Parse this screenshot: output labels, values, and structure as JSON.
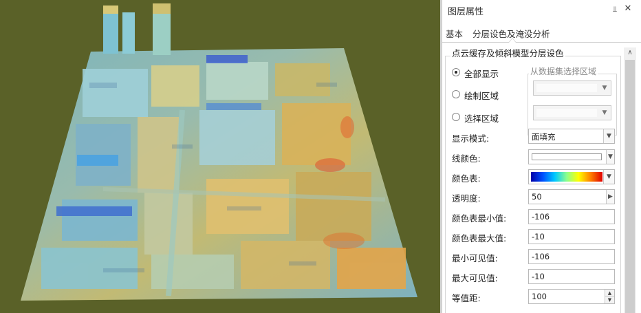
{
  "panel": {
    "title": "图层属性",
    "pin_icon": "pin-icon",
    "close_icon": "close-icon",
    "tabs": [
      {
        "label": "基本"
      },
      {
        "label": "分层设色及淹没分析"
      }
    ]
  },
  "group": {
    "title": "点云缓存及倾斜模型分层设色",
    "radios": [
      {
        "label": "全部显示",
        "selected": true
      },
      {
        "label": "绘制区域",
        "selected": false
      },
      {
        "label": "选择区域",
        "selected": false
      }
    ],
    "region_title": "从数据集选择区域"
  },
  "props": {
    "display_mode": {
      "label": "显示模式:",
      "value": "面填充"
    },
    "line_color": {
      "label": "线颜色:",
      "value": "#ffffff"
    },
    "color_table": {
      "label": "颜色表:",
      "colors": [
        "#0000a8",
        "#0050ff",
        "#00c8ff",
        "#8cff8c",
        "#ffff00",
        "#ff8000",
        "#e00000"
      ]
    },
    "opacity": {
      "label": "透明度:",
      "value": "50"
    },
    "color_min": {
      "label": "颜色表最小值:",
      "value": "-106"
    },
    "color_max": {
      "label": "颜色表最大值:",
      "value": "-10"
    },
    "visible_min": {
      "label": "最小可见值:",
      "value": "-106"
    },
    "visible_max": {
      "label": "最大可见值:",
      "value": "-10"
    },
    "interval": {
      "label": "等值距:",
      "value": "100"
    }
  },
  "viewport": {
    "background": "#5a6128",
    "description_colors": [
      "#6fb3c8",
      "#c9b860",
      "#e0a030",
      "#3a6fc8",
      "#d2d2b0"
    ]
  }
}
